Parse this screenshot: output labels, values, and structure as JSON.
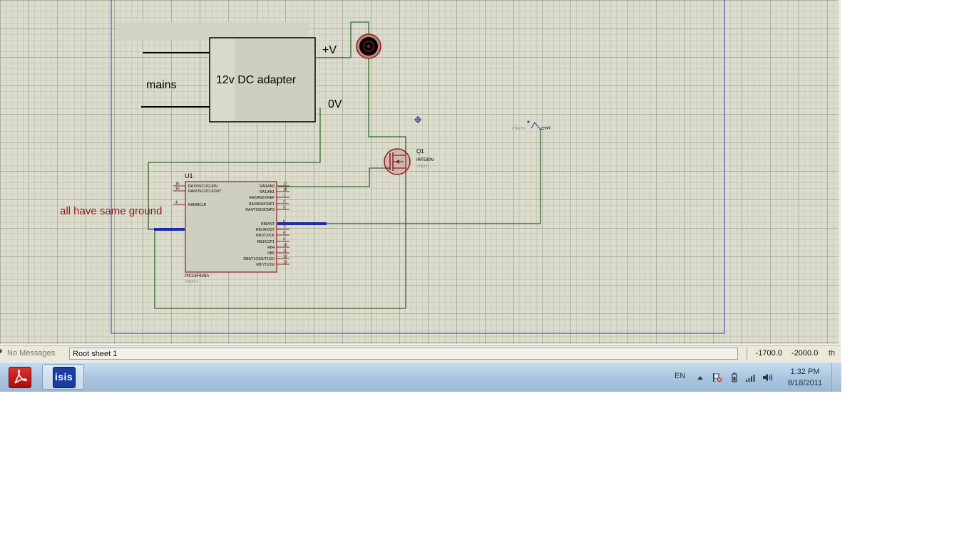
{
  "schematic": {
    "labels": {
      "mains": "mains",
      "adapter": "12v DC adapter",
      "plus_v": "+V",
      "zero_v": "0V",
      "note": "all have same ground"
    },
    "u1": {
      "ref": "U1",
      "part": "PIC16F628A",
      "text": "<TEXT>",
      "left_pins": [
        {
          "num": "16",
          "name": "RA7/OSC1/CLKIN"
        },
        {
          "num": "15",
          "name": "RA6/OSC2/CLKOUT"
        },
        {
          "num": "4",
          "name": "RA5/MCLR"
        }
      ],
      "right_pins": [
        {
          "num": "17",
          "name": "RA0/AN0"
        },
        {
          "num": "18",
          "name": "RA1/AN1"
        },
        {
          "num": "1",
          "name": "RA2/AN2/VREF"
        },
        {
          "num": "2",
          "name": "RA3/AN3/CMP1"
        },
        {
          "num": "3",
          "name": "RA4/T0CKI/CMP2"
        },
        {
          "num": "6",
          "name": "RB0/INT"
        },
        {
          "num": "7",
          "name": "RB1/RX/DT"
        },
        {
          "num": "8",
          "name": "RB2/TX/CK"
        },
        {
          "num": "9",
          "name": "RB3/CCP1"
        },
        {
          "num": "10",
          "name": "RB4"
        },
        {
          "num": "11",
          "name": "RB5"
        },
        {
          "num": "12",
          "name": "RB6/T1OSO/T1CKI"
        },
        {
          "num": "13",
          "name": "RB7/T1OSI"
        }
      ]
    },
    "q1": {
      "ref": "Q1",
      "part": "IRF530N",
      "text": "<TEXT>"
    },
    "switch": {
      "text": "<TEXT>"
    }
  },
  "statusbar": {
    "messages": "No Messages",
    "sheet": "Root sheet 1",
    "coord_x": "-1700.0",
    "coord_y": "-2000.0",
    "units": "th"
  },
  "taskbar": {
    "isis_label": "isis",
    "lang": "EN",
    "time": "1:32 PM",
    "date": "8/18/2011"
  }
}
